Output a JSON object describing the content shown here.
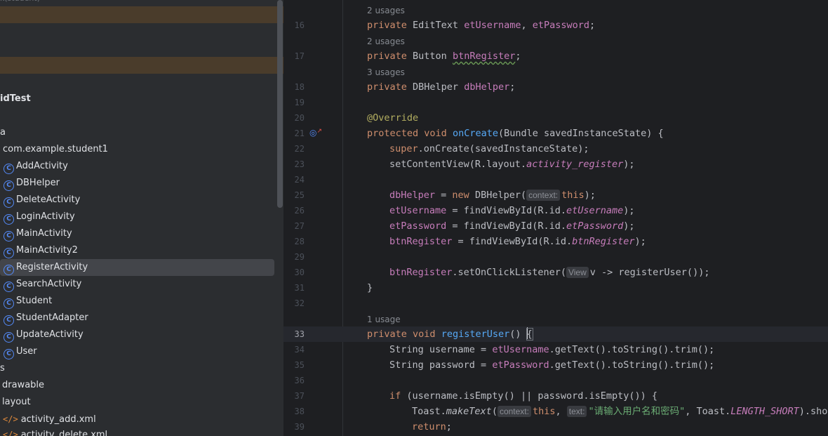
{
  "tree": {
    "top_path": "k(student)",
    "android_test": "idTest",
    "java_folder": "a",
    "package": "com.example.student1",
    "classes": [
      "AddActivity",
      "DBHelper",
      "DeleteActivity",
      "LoginActivity",
      "MainActivity",
      "MainActivity2",
      "RegisterActivity",
      "SearchActivity",
      "Student",
      "StudentAdapter",
      "UpdateActivity",
      "User"
    ],
    "selected_class": "RegisterActivity",
    "res_folder": "s",
    "drawable": "drawable",
    "layout": "layout",
    "xml_files": [
      "activity_add.xml",
      "activity_delete.xml"
    ],
    "class_icon_glyph": "C",
    "xml_icon_glyph": "</>"
  },
  "editor": {
    "usages": {
      "u1": "2 usages",
      "u2": "2 usages",
      "u3": "3 usages",
      "u4": "1 usage"
    },
    "line_numbers": [
      "16",
      "17",
      "18",
      "19",
      "20",
      "21",
      "22",
      "23",
      "24",
      "25",
      "26",
      "27",
      "28",
      "29",
      "30",
      "31",
      "32",
      "33",
      "34",
      "35",
      "36",
      "37",
      "38",
      "39"
    ],
    "active_line": "33",
    "hints": {
      "context": "context:",
      "view": "View",
      "text": "text:"
    },
    "code": {
      "l16": [
        "private",
        " EditText ",
        "etUsername",
        ", ",
        "etPassword",
        ";"
      ],
      "l17": [
        "private",
        " Button ",
        "btnRegister",
        ";"
      ],
      "l18": [
        "private",
        " DBHelper ",
        "dbHelper",
        ";"
      ],
      "l20": "@Override",
      "l21": [
        "protected",
        " ",
        "void",
        " ",
        "onCreate",
        "(Bundle savedInstanceState) {"
      ],
      "l22": [
        "super",
        ".onCreate(savedInstanceState);"
      ],
      "l23": [
        "setContentView(R.layout.",
        "activity_register",
        ");"
      ],
      "l25": [
        "dbHelper",
        " = ",
        "new",
        " DBHelper(",
        "this",
        ");"
      ],
      "l26": [
        "etUsername",
        " = findViewById(R.id.",
        "etUsername",
        ");"
      ],
      "l27": [
        "etPassword",
        " = findViewById(R.id.",
        "etPassword",
        ");"
      ],
      "l28": [
        "btnRegister",
        " = findViewById(R.id.",
        "btnRegister",
        ");"
      ],
      "l30": [
        "btnRegister",
        ".setOnClickListener(",
        "v -> registerUser());"
      ],
      "l31": "}",
      "l33": [
        "private",
        " ",
        "void",
        " ",
        "registerUser",
        "() ",
        "{"
      ],
      "l34": [
        "String username = ",
        "etUsername",
        ".getText().toString().trim();"
      ],
      "l35": [
        "String password = ",
        "etPassword",
        ".getText().toString().trim();"
      ],
      "l37": [
        "if",
        " (username.isEmpty() || password.isEmpty()) {"
      ],
      "l38": [
        "Toast.",
        "makeText",
        "(",
        "this",
        ", ",
        "\"请输入用户名和密码\"",
        ", Toast.",
        "LENGTH_SHORT",
        ").sho"
      ],
      "l39": [
        "return",
        ";"
      ]
    }
  }
}
